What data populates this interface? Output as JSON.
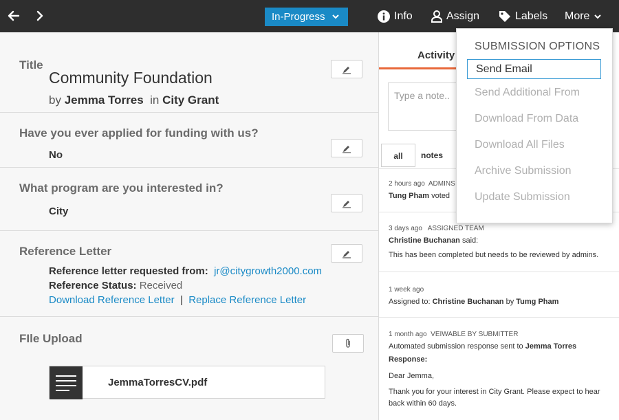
{
  "topbar": {
    "back_label": "←",
    "forward_label": "›",
    "status_label": "In-Progress",
    "status_chevron": "⌄",
    "info_label": "Info",
    "assign_label": "Assign",
    "labels_label": "Labels",
    "more_label": "More",
    "more_chevron": "⌄"
  },
  "submission": {
    "title_label": "Title",
    "title": "Community Foundation",
    "by_word": "by",
    "author": "Jemma Torres",
    "in_word": "in",
    "program": "City Grant"
  },
  "questions": [
    {
      "title": "Have you ever applied for funding with us?",
      "value": "No"
    },
    {
      "title": "What program are you interested in?",
      "value": "City"
    }
  ],
  "reference": {
    "title": "Reference Letter",
    "requested_label": "Reference letter requested from:",
    "requested_email": "jr@citygrowth2000.com",
    "status_label": "Reference Status:",
    "status_value": "Received",
    "download_link": "Download Reference Letter",
    "separator": "|",
    "replace_link": "Replace Reference Letter"
  },
  "file_upload": {
    "title": "FIle Upload",
    "file_name": "JemmaTorresCV.pdf"
  },
  "activity": {
    "tab_label": "Activity",
    "note_placeholder": "Type a note..",
    "filter_all": "all",
    "filter_notes": "notes",
    "items": [
      {
        "time": "2 hours ago",
        "tag": "ADMINS",
        "name": "Tung Pham",
        "text": "voted"
      },
      {
        "time": "3 days ago",
        "tag": "ASSIGNED TEAM",
        "name": "Christine Buchanan",
        "said": "said:",
        "text": "This has been completed but needs to be reviewed by admins."
      },
      {
        "time": "1 week ago",
        "assigned_label": "Assigned to:",
        "assignee": "Christine Buchanan",
        "by_word": "by",
        "assigner": "Tumg Pham"
      },
      {
        "time": "1 month ago",
        "tag": "VEIWABLE BY SUBMITTER",
        "text": "Automated submission response sent to",
        "recipient": "Jemma Torres",
        "response_label": "Response:",
        "greeting": "Dear Jemma,",
        "body": "Thank you for your interest in City Grant. Please expect to hear back within 60 days."
      }
    ]
  },
  "dropdown": {
    "header": "SUBMISSION OPTIONS",
    "active_item": "Send Email",
    "items": [
      "Send Additional From",
      "Download From Data",
      "Download All Files",
      "Archive Submission",
      "Update Submission"
    ]
  },
  "colors": {
    "topbar": "#2e2e2e",
    "accent_blue": "#1a8ac6",
    "activity_underline": "#e8683a"
  }
}
